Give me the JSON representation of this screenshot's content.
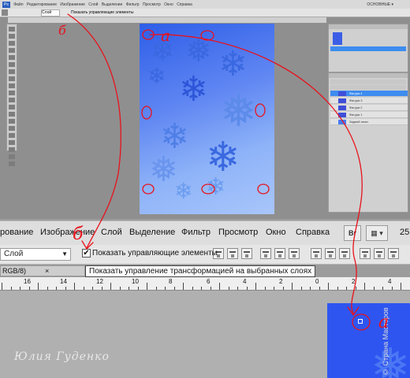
{
  "top_screenshot": {
    "menubar_items": [
      "Файл",
      "Редактирование",
      "Изображение",
      "Слой",
      "Выделение",
      "Фильтр",
      "Просмотр",
      "Окно",
      "Справка"
    ],
    "workspace_label": "ОСНОВНЫЕ ▾",
    "options_select": "Слой",
    "options_checkbox_label": "Показать управляющие элементы",
    "layers": [
      {
        "name": "Фигура 4"
      },
      {
        "name": "Фигура 3"
      },
      {
        "name": "Фигура 2"
      },
      {
        "name": "Фигура 1"
      },
      {
        "name": "Задний план"
      }
    ],
    "selected_layer_index": 0,
    "canvas_gradient": [
      "#2e5ee8",
      "#a9c6fb"
    ]
  },
  "zoom_menu": {
    "items": [
      "рование",
      "Изображение",
      "Слой",
      "Выделение",
      "Фильтр",
      "Просмотр",
      "Окно",
      "Справка"
    ],
    "br_button": "Br",
    "right_number": "25"
  },
  "zoom_options": {
    "layer_select": "Слой",
    "checkbox_checked": true,
    "checkbox_label": "Показать управляющие элементы",
    "tooltip": "Показать управление трансформацией на выбранных слоях"
  },
  "doc_tab": {
    "label": "RGB/8)",
    "close": "×"
  },
  "ruler": {
    "labels": [
      "16",
      "14",
      "12",
      "10",
      "8",
      "6",
      "4",
      "2",
      "0",
      "2",
      "4"
    ]
  },
  "annotations": {
    "a1": "а",
    "b1": "б",
    "b2": "б",
    "a2": "а"
  },
  "author_signature": "Юлия Гуденко",
  "watermark": "© Страна Мастеров",
  "colors": {
    "annotation_red": "#e8121c",
    "canvas_blue": "#2f55f0",
    "highlight_blue": "#3d8cf0"
  }
}
